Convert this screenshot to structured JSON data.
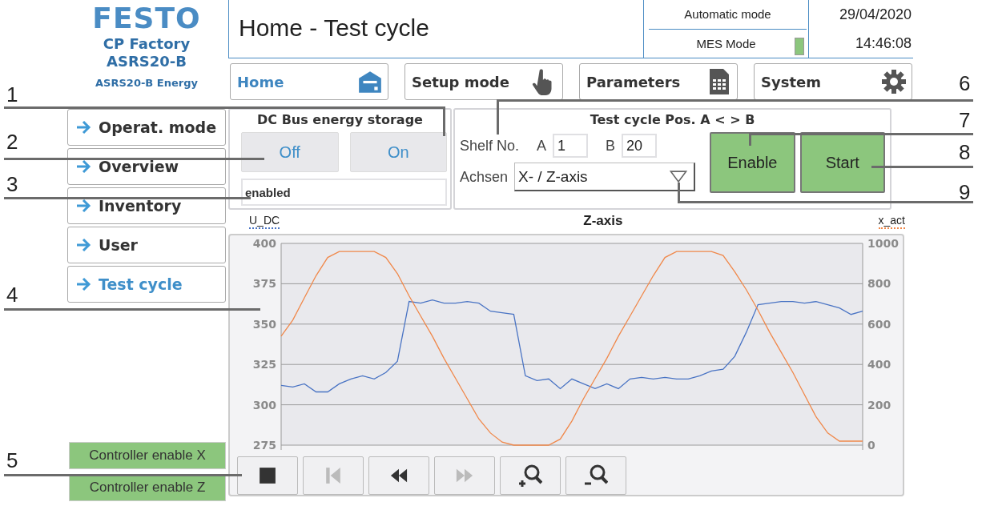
{
  "logo": {
    "brand": "FESTO",
    "line_1": "CP Factory",
    "line_2": "ASRS20-B",
    "line_3": "ASRS20-B Energy"
  },
  "header": {
    "title": "Home - Test cycle",
    "mode": "Automatic mode",
    "mes_mode": "MES Mode",
    "mes_on": true,
    "date": "29/04/2020",
    "time": "14:46:08"
  },
  "nav_tabs": [
    {
      "label": "Home",
      "kind": "home",
      "selected": true
    },
    {
      "label": "Setup mode",
      "kind": "hand",
      "selected": false
    },
    {
      "label": "Parameters",
      "kind": "sheet",
      "selected": false
    },
    {
      "label": "System",
      "kind": "gear",
      "selected": false
    }
  ],
  "sidebar": {
    "items": [
      {
        "label": "Operat. mode",
        "selected": false
      },
      {
        "label": "Overview",
        "selected": false
      },
      {
        "label": "Inventory",
        "selected": false
      },
      {
        "label": "User",
        "selected": false
      },
      {
        "label": "Test cycle",
        "selected": true
      }
    ],
    "indicators": [
      {
        "label": "Controller enable X",
        "on": true
      },
      {
        "label": "Controller enable Z",
        "on": true
      }
    ]
  },
  "dc_bus": {
    "title": "DC Bus energy storage",
    "buttons": [
      "Off",
      "On"
    ],
    "status": "enabled"
  },
  "test_cycle": {
    "title": "Test cycle Pos. A < > B",
    "shelf_label": "Shelf No.",
    "a_label": "A",
    "a_value": "1",
    "b_label": "B",
    "b_value": "20",
    "axes_label": "Achsen",
    "axes_value": "X- / Z-axis",
    "buttons": [
      "Enable",
      "Start"
    ]
  },
  "chart": {
    "layers": [
      {
        "chart_data": {
          "type": "line",
          "title": "Z-axis",
          "grid": true,
          "ylim": [
            275,
            400
          ],
          "yticks": [
            275,
            300,
            325,
            350,
            375,
            400
          ],
          "series": [
            {
              "name": "U_DC",
              "color": "#4a74c4",
              "values": [
                312,
                311,
                313,
                308,
                308,
                313,
                316,
                318,
                316,
                320,
                327,
                364,
                363,
                365,
                363,
                363,
                364,
                363,
                358,
                357,
                356,
                318,
                315,
                316,
                310,
                316,
                313,
                310,
                313,
                310,
                316,
                317,
                316,
                317,
                316,
                316,
                318,
                321,
                322,
                330,
                345,
                362,
                363,
                364,
                364,
                363,
                364,
                362,
                360,
                356,
                358
              ]
            }
          ]
        }
      },
      {
        "chart_data": {
          "type": "line",
          "grid": false,
          "ylim": [
            0,
            1000
          ],
          "yticks": [
            0,
            200,
            400,
            600,
            800,
            1000
          ],
          "series": [
            {
              "name": "x_act",
              "color": "#f0884a",
              "values": [
                540,
                620,
                730,
                840,
                930,
                960,
                960,
                960,
                960,
                930,
                850,
                740,
                640,
                540,
                430,
                330,
                230,
                130,
                60,
                15,
                0,
                0,
                0,
                0,
                30,
                120,
                230,
                330,
                430,
                540,
                640,
                740,
                840,
                930,
                960,
                960,
                960,
                960,
                940,
                860,
                770,
                670,
                560,
                460,
                360,
                250,
                140,
                60,
                20,
                20,
                20
              ]
            }
          ]
        }
      }
    ],
    "toolbar": [
      {
        "kind": "stop",
        "disabled": false
      },
      {
        "kind": "first",
        "disabled": true
      },
      {
        "kind": "rewind",
        "disabled": false
      },
      {
        "kind": "forward",
        "disabled": true
      },
      {
        "kind": "zoom_in",
        "disabled": false
      },
      {
        "kind": "zoom_out",
        "disabled": false
      }
    ]
  },
  "callouts": [
    {
      "label": "1"
    },
    {
      "label": "2"
    },
    {
      "label": "3"
    },
    {
      "label": "4"
    },
    {
      "label": "5"
    },
    {
      "label": "6"
    },
    {
      "label": "7"
    },
    {
      "label": "8"
    },
    {
      "label": "9"
    }
  ]
}
